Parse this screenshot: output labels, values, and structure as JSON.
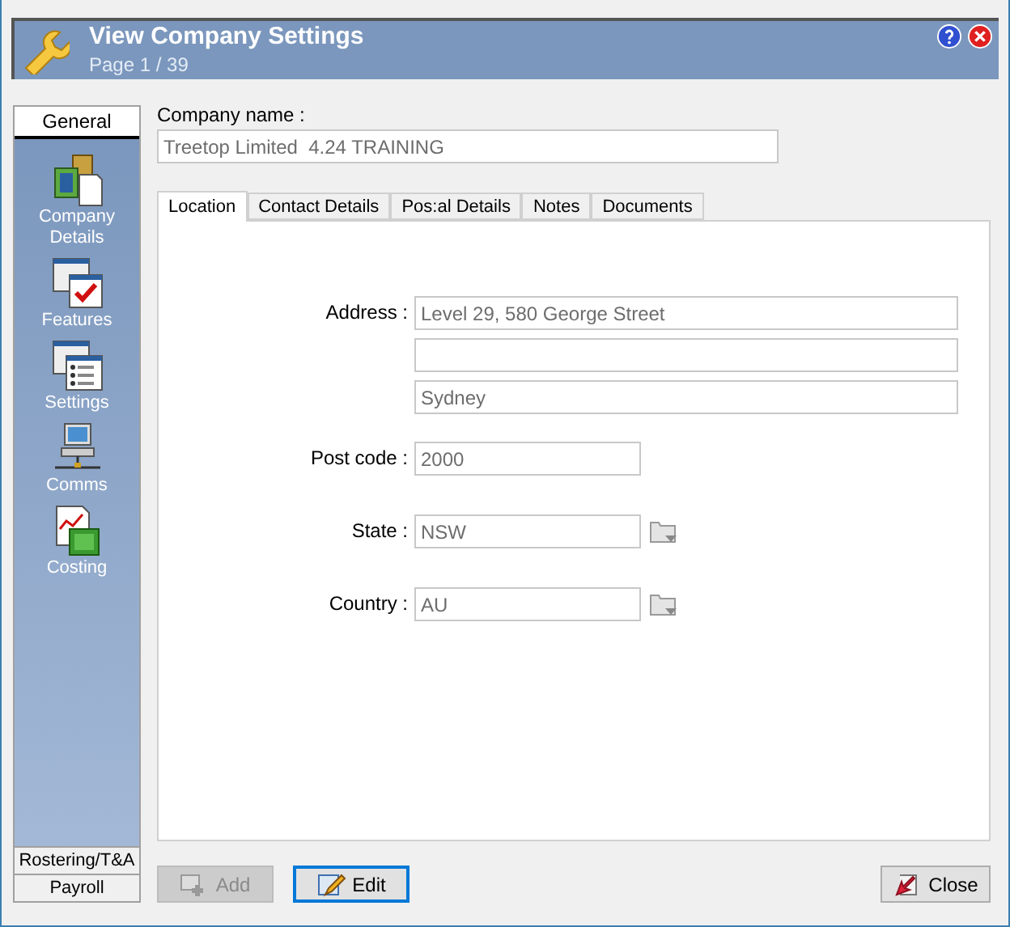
{
  "header": {
    "title": "View Company Settings",
    "subtitle": "Page 1 / 39"
  },
  "sidebar": {
    "sections": [
      {
        "label": "General",
        "selected": true
      },
      {
        "label": "Rostering/T&A",
        "selected": false
      },
      {
        "label": "Payroll",
        "selected": false
      }
    ],
    "items": [
      {
        "label": "Company Details",
        "kind": "company"
      },
      {
        "label": "Features",
        "kind": "features"
      },
      {
        "label": "Settings",
        "kind": "settings"
      },
      {
        "label": "Comms",
        "kind": "comms"
      },
      {
        "label": "Costing",
        "kind": "costing"
      }
    ]
  },
  "company_name": {
    "label": "Company name :",
    "value": "Treetop Limited  4.24 TRAINING"
  },
  "tabs": [
    {
      "label": "Location",
      "selected": true
    },
    {
      "label": "Contact Details",
      "selected": false
    },
    {
      "label": "Pos:al Details",
      "selected": false
    },
    {
      "label": "Notes",
      "selected": false
    },
    {
      "label": "Documents",
      "selected": false
    }
  ],
  "fields": [
    {
      "label": "Address :",
      "values": [
        {
          "kind": "text",
          "value": "Level 29, 580 George Street"
        },
        {
          "kind": "blank"
        },
        {
          "kind": "text",
          "value": "Sydney"
        }
      ],
      "kind": "wide"
    },
    {
      "label": "Post code :",
      "values": [
        {
          "kind": "text",
          "value": "2000"
        }
      ],
      "kind": "short"
    },
    {
      "label": "State :",
      "values": [
        {
          "kind": "text",
          "value": "NSW"
        }
      ],
      "kind": "lookup"
    },
    {
      "label": "Country :",
      "values": [
        {
          "kind": "text",
          "value": "AU"
        }
      ],
      "kind": "lookup"
    }
  ],
  "buttons": [
    {
      "label": "Add",
      "kind": "add",
      "disabled": true,
      "focused": false
    },
    {
      "label": "Edit",
      "kind": "edit",
      "disabled": false,
      "focused": true
    },
    {
      "label": "Close",
      "kind": "close",
      "disabled": false,
      "focused": false
    }
  ]
}
